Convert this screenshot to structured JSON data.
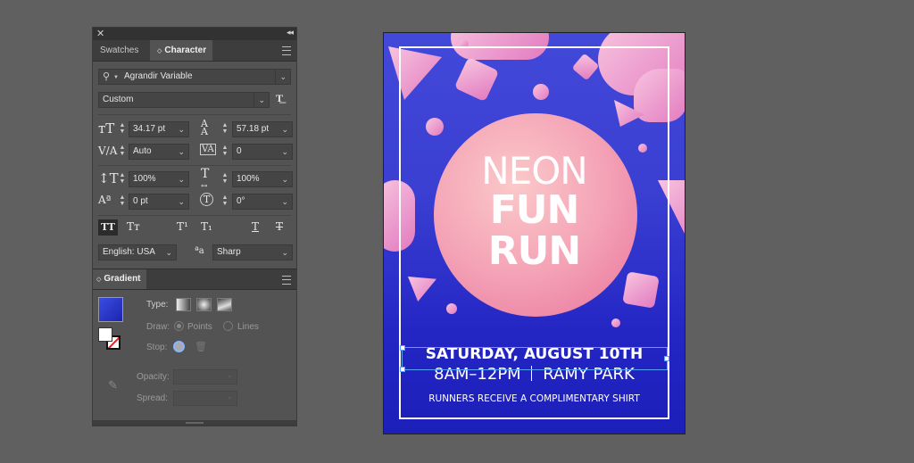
{
  "panel": {
    "tabs": {
      "swatches": "Swatches",
      "character": "Character"
    },
    "font_family": "Agrandir Variable",
    "font_style": "Custom",
    "font_size": "34.17 pt",
    "leading": "57.18 pt",
    "kerning": "Auto",
    "tracking": "0",
    "vertical_scale": "100%",
    "horizontal_scale": "100%",
    "baseline_shift": "0 pt",
    "rotation": "0°",
    "language": "English: USA",
    "antialias": "Sharp",
    "style_buttons": {
      "all_caps": "TT",
      "small_caps": "Tт",
      "superscript": "T¹",
      "subscript": "T₁",
      "underline": "T",
      "strikethrough": "T"
    }
  },
  "gradient": {
    "title": "Gradient",
    "type_label": "Type:",
    "draw_label": "Draw:",
    "points_label": "Points",
    "lines_label": "Lines",
    "stop_label": "Stop:",
    "opacity_label": "Opacity:",
    "spread_label": "Spread:"
  },
  "poster": {
    "line1": "NEON",
    "line2": "FUN",
    "line3": "RUN",
    "date": "SATURDAY, AUGUST 10TH",
    "time": "8AM–12PM",
    "place": "RAMY PARK",
    "footer": "RUNNERS RECEIVE A COMPLIMENTARY SHIRT"
  },
  "colors": {
    "gradient_swatch": "#2a35c8",
    "poster_blue": "#3a3fd2",
    "accent_pink": "#e27ac0"
  }
}
